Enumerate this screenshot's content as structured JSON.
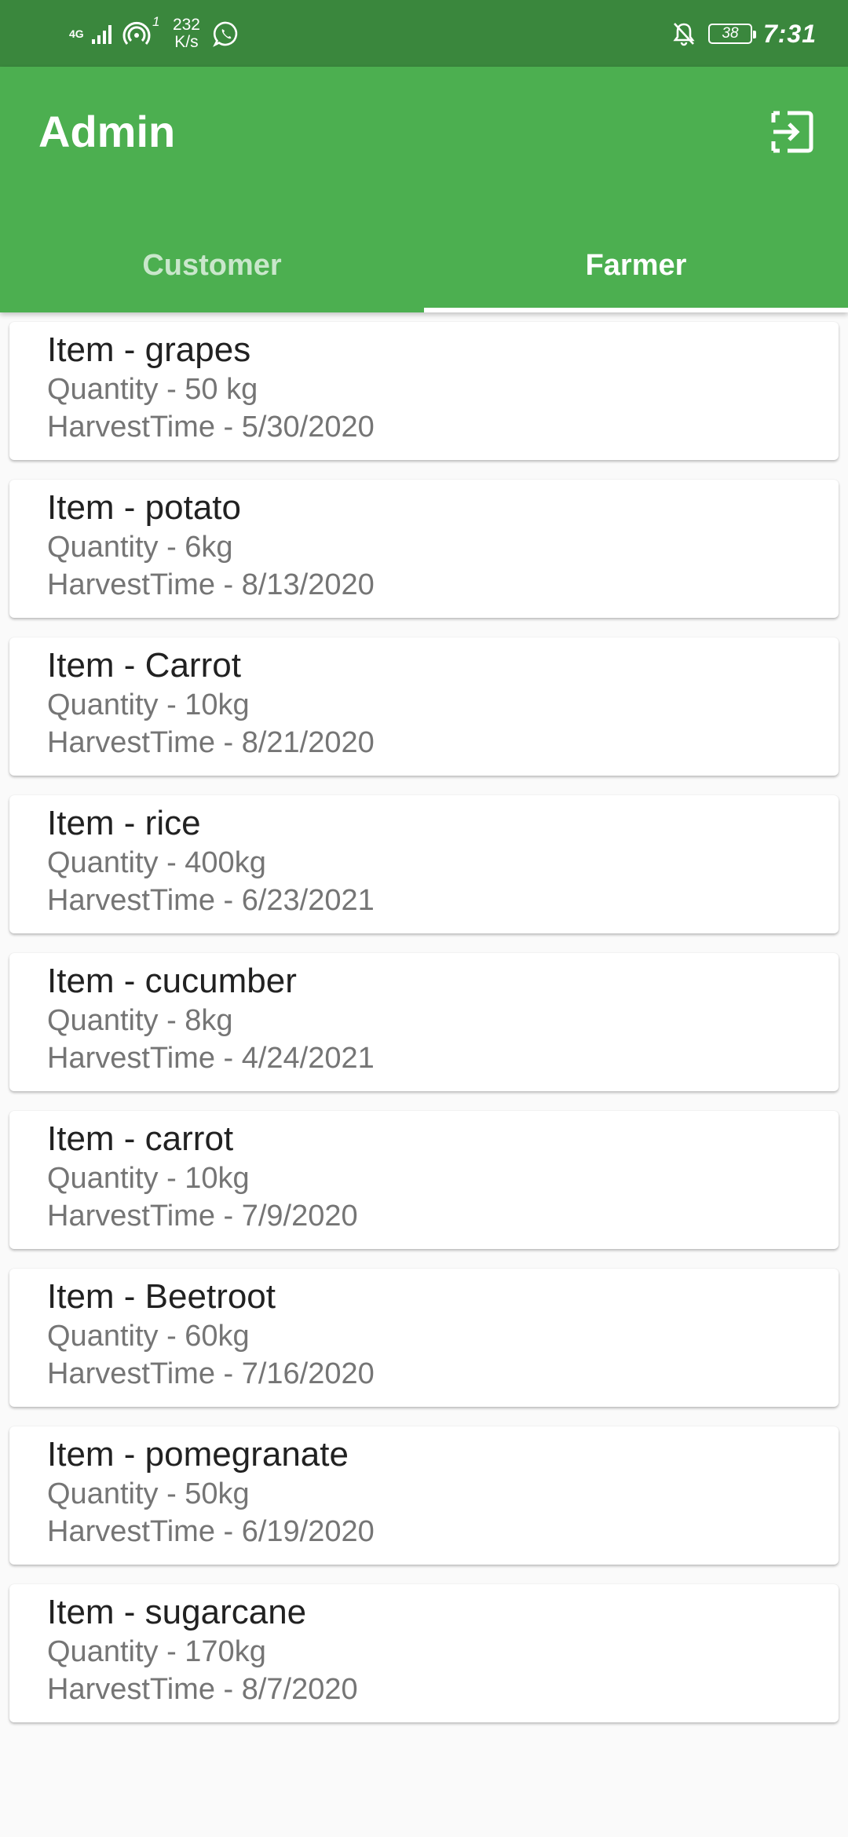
{
  "status_bar": {
    "network_type": "4G",
    "hotspot_count": "1",
    "speed_value": "232",
    "speed_unit": "K/s",
    "battery": "38",
    "time": "7:31"
  },
  "app_bar": {
    "title": "Admin",
    "logout_icon": "logout-icon",
    "tabs": [
      {
        "label": "Customer",
        "selected": false
      },
      {
        "label": "Farmer",
        "selected": true
      }
    ]
  },
  "colors": {
    "primary": "#4caf50",
    "primary_dark": "#3a873d"
  },
  "items": [
    {
      "item": "Item - grapes",
      "quantity": "Quantity - 50 kg",
      "harvest": "HarvestTime - 5/30/2020"
    },
    {
      "item": "Item - potato",
      "quantity": "Quantity - 6kg",
      "harvest": "HarvestTime - 8/13/2020"
    },
    {
      "item": "Item - Carrot",
      "quantity": "Quantity - 10kg",
      "harvest": "HarvestTime - 8/21/2020"
    },
    {
      "item": "Item - rice",
      "quantity": "Quantity - 400kg",
      "harvest": "HarvestTime - 6/23/2021"
    },
    {
      "item": "Item - cucumber",
      "quantity": "Quantity - 8kg",
      "harvest": "HarvestTime - 4/24/2021"
    },
    {
      "item": "Item - carrot",
      "quantity": "Quantity - 10kg",
      "harvest": "HarvestTime - 7/9/2020"
    },
    {
      "item": "Item - Beetroot",
      "quantity": "Quantity - 60kg",
      "harvest": "HarvestTime - 7/16/2020"
    },
    {
      "item": "Item - pomegranate",
      "quantity": "Quantity - 50kg",
      "harvest": "HarvestTime - 6/19/2020"
    },
    {
      "item": "Item - sugarcane",
      "quantity": "Quantity - 170kg",
      "harvest": "HarvestTime - 8/7/2020"
    }
  ]
}
